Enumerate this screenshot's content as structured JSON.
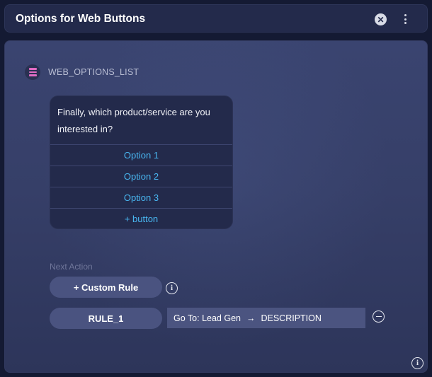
{
  "header": {
    "title": "Options for Web Buttons",
    "close_icon": "close-circle-icon",
    "menu_icon": "kebab-menu-icon"
  },
  "node": {
    "icon": "list-icon",
    "name": "WEB_OPTIONS_LIST",
    "message": "Finally, which product/service are you interested in?",
    "options": [
      "Option 1",
      "Option 2",
      "Option 3"
    ],
    "add_button_label": "+ button"
  },
  "next_action": {
    "label": "Next Action",
    "custom_rule_label": "+ Custom Rule",
    "rule": {
      "name": "RULE_1",
      "prefix": "Go To: Lead Gen",
      "arrow": "→",
      "target": "DESCRIPTION"
    }
  },
  "colors": {
    "accent_link": "#49b6f0",
    "node_icon": "#e06cc4",
    "header_bg": "#232a4b"
  }
}
